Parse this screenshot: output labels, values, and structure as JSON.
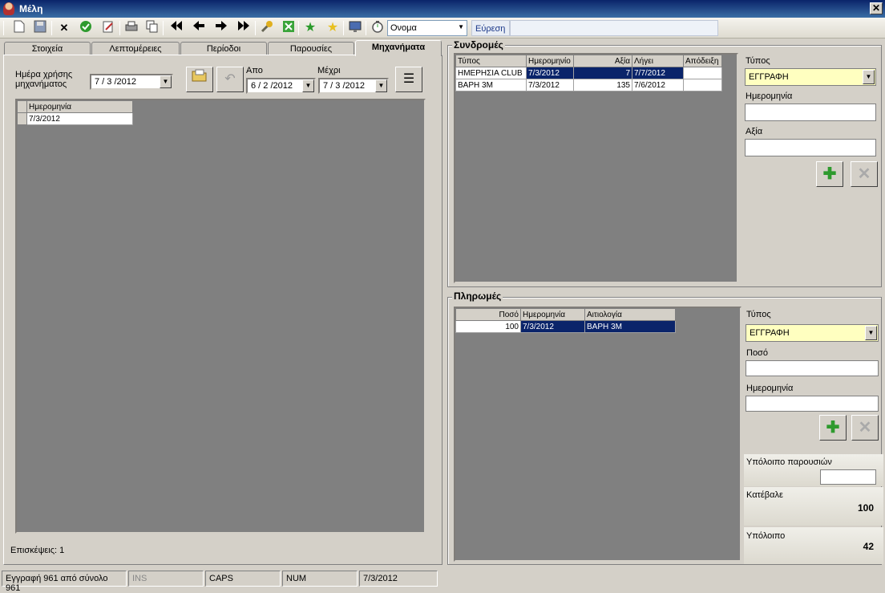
{
  "window": {
    "title": "Μέλη",
    "close_glyph": "✕"
  },
  "toolbar": {
    "search_field_value": "Ονομα",
    "find_label": "Εύρεση",
    "icons": [
      "new-icon",
      "save-icon",
      "delete-icon",
      "confirm-icon",
      "edit-icon",
      "print-icon",
      "copy-icon",
      "first-icon",
      "prev-icon",
      "next-icon",
      "last-icon",
      "tools-icon",
      "export-excel-icon",
      "star-green-icon",
      "star-yellow-icon",
      "monitor-icon",
      "stopwatch-icon"
    ]
  },
  "tabs": [
    {
      "label": "Στοιχεία"
    },
    {
      "label": "Λεπτομέρειες"
    },
    {
      "label": "Περίοδοι"
    },
    {
      "label": "Παρουσίες"
    },
    {
      "label": "Μηχανήματα"
    }
  ],
  "machines": {
    "usage_day_label": "Ημέρα χρήσης μηχανήματος",
    "usage_day_value": "7 / 3 /2012",
    "from_label": "Απο",
    "from_value": "6 / 2 /2012",
    "to_label": "Μέχρι",
    "to_value": "7 / 3 /2012",
    "grid_header": "Ημερομηνία",
    "grid_rows": [
      "7/3/2012"
    ],
    "visits_text": "Επισκέψεις: 1"
  },
  "subscriptions": {
    "title": "Συνδρομές",
    "columns": [
      "Τύπος",
      "Ημερομηνίο",
      "Αξία",
      "Λήγει",
      "Απόδειξη"
    ],
    "rows": [
      {
        "type": "ΗΜΕΡΗΣΙΑ CLUB",
        "date": "7/3/2012",
        "value": "7",
        "expires": "7/7/2012",
        "receipt": ""
      },
      {
        "type": "ΒΑΡΗ 3Μ",
        "date": "7/3/2012",
        "value": "135",
        "expires": "7/6/2012",
        "receipt": ""
      }
    ],
    "form": {
      "type_label": "Τύπος",
      "type_value": "ΕΓΓΡΑΦΗ",
      "date_label": "Ημερομηνία",
      "value_label": "Αξία"
    }
  },
  "payments": {
    "title": "Πληρωμές",
    "columns": [
      "Ποσό",
      "Ημερομηνία",
      "Αιτιολογία"
    ],
    "rows": [
      {
        "amount": "100",
        "date": "7/3/2012",
        "reason": "ΒΑΡΗ 3Μ"
      }
    ],
    "form": {
      "type_label": "Τύπος",
      "type_value": "ΕΓΓΡΑΦΗ",
      "amount_label": "Ποσό",
      "date_label": "Ημερομηνία"
    },
    "attendance_balance_label": "Υπόλοιπο παρουσιών",
    "paid_label": "Κατέβαλε",
    "paid_value": "100",
    "balance_label": "Υπόλοιπο",
    "balance_value": "42"
  },
  "statusbar": {
    "record": "Εγγραφή 961 από σύνολο 961",
    "ins": "INS",
    "caps": "CAPS",
    "num": "NUM",
    "date": "7/3/2012"
  }
}
